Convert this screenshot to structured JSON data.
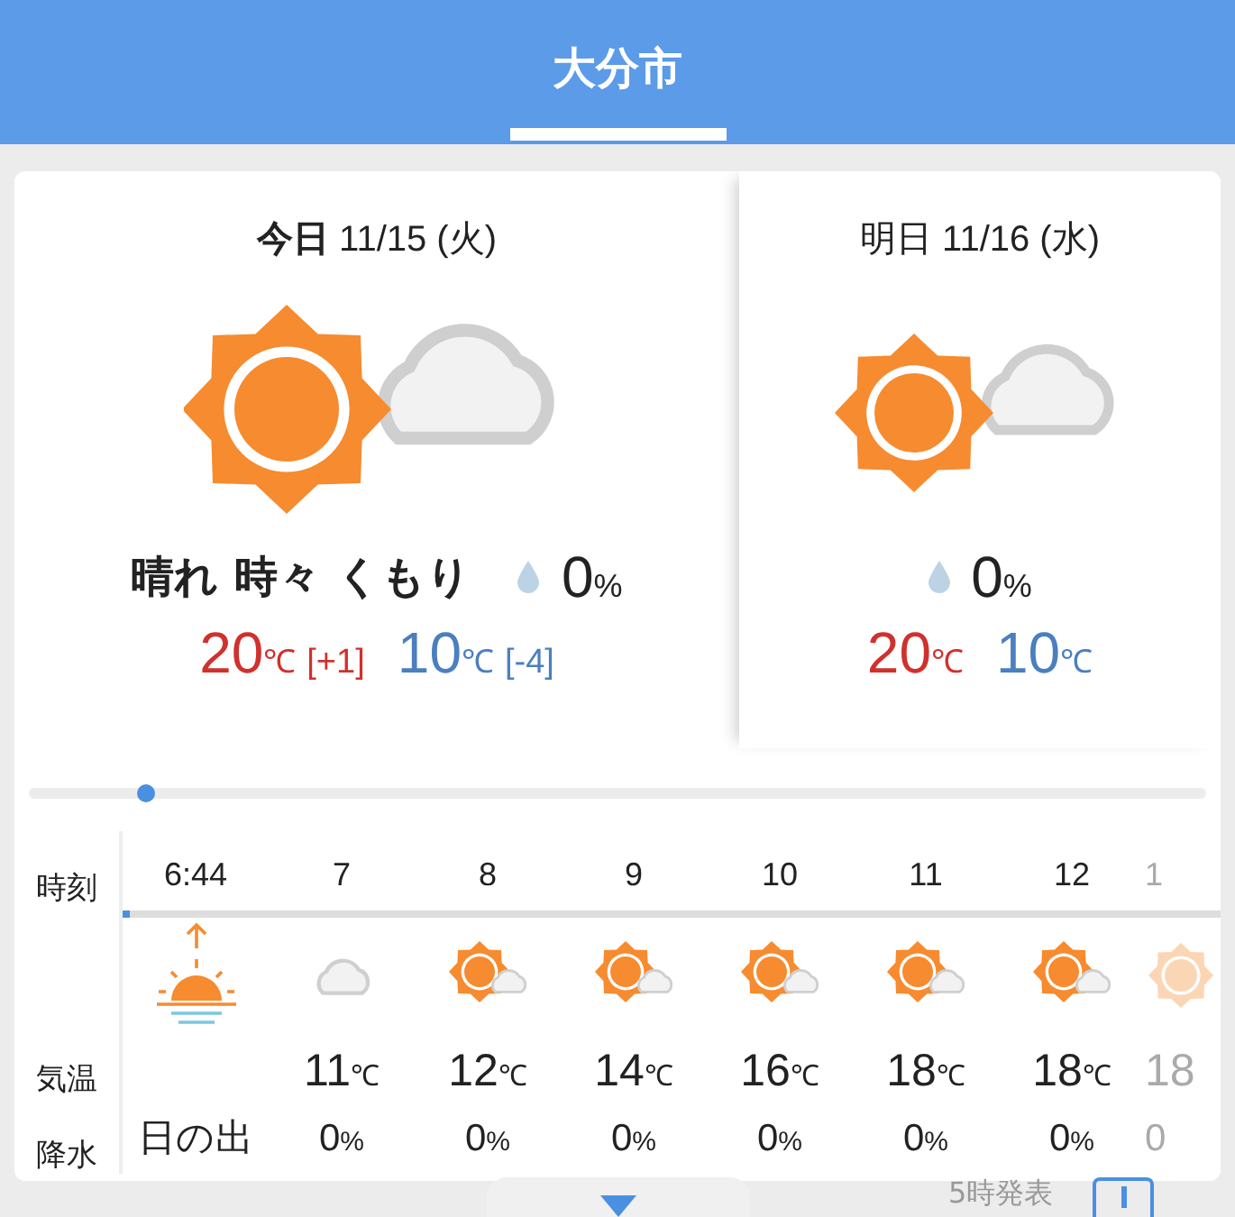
{
  "header": {
    "tabs": [
      {
        "label": "大分市",
        "selected": true
      }
    ]
  },
  "days": [
    {
      "date": "**今日** 11/15 (火)",
      "kind": "sun_cloud",
      "condition": "晴れ 時々 くもり",
      "precip": "0",
      "precip_unit": "%",
      "high": "20",
      "high_unit": "℃",
      "high_diff": "[+1]",
      "low": "10",
      "low_unit": "℃",
      "low_diff": "[-4]"
    },
    {
      "date": "明日 11/16 (水)",
      "kind": "sun_cloud",
      "precip": "0",
      "precip_unit": "%",
      "high": "20",
      "high_unit": "℃",
      "low": "10",
      "low_unit": "℃"
    }
  ],
  "timeline": {
    "level": 0.1
  },
  "hourly": {
    "row_labels": [
      "時刻",
      "気温",
      "降水"
    ],
    "hours": [
      {
        "time": "6:44",
        "kind": "sunrise",
        "precip": "日の出",
        "faded": false
      },
      {
        "time": "7",
        "kind": "cloud",
        "temp": "11",
        "temp_unit": "℃",
        "precip": "0",
        "precip_unit": "%",
        "faded": false
      },
      {
        "time": "8",
        "kind": "sun_cloud",
        "temp": "12",
        "temp_unit": "℃",
        "precip": "0",
        "precip_unit": "%",
        "faded": false
      },
      {
        "time": "9",
        "kind": "sun_cloud",
        "temp": "14",
        "temp_unit": "℃",
        "precip": "0",
        "precip_unit": "%",
        "faded": false
      },
      {
        "time": "10",
        "kind": "sun_cloud",
        "temp": "16",
        "temp_unit": "℃",
        "precip": "0",
        "precip_unit": "%",
        "faded": false
      },
      {
        "time": "11",
        "kind": "sun_cloud",
        "temp": "18",
        "temp_unit": "℃",
        "precip": "0",
        "precip_unit": "%",
        "faded": false
      },
      {
        "time": "12",
        "kind": "sun_cloud",
        "temp": "18",
        "temp_unit": "℃",
        "precip": "0",
        "precip_unit": "%",
        "faded": false
      },
      {
        "time": "1",
        "kind": "sun",
        "temp": "18",
        "precip": "0",
        "faded": true
      }
    ]
  },
  "footer": {
    "issued": "5時発表"
  }
}
